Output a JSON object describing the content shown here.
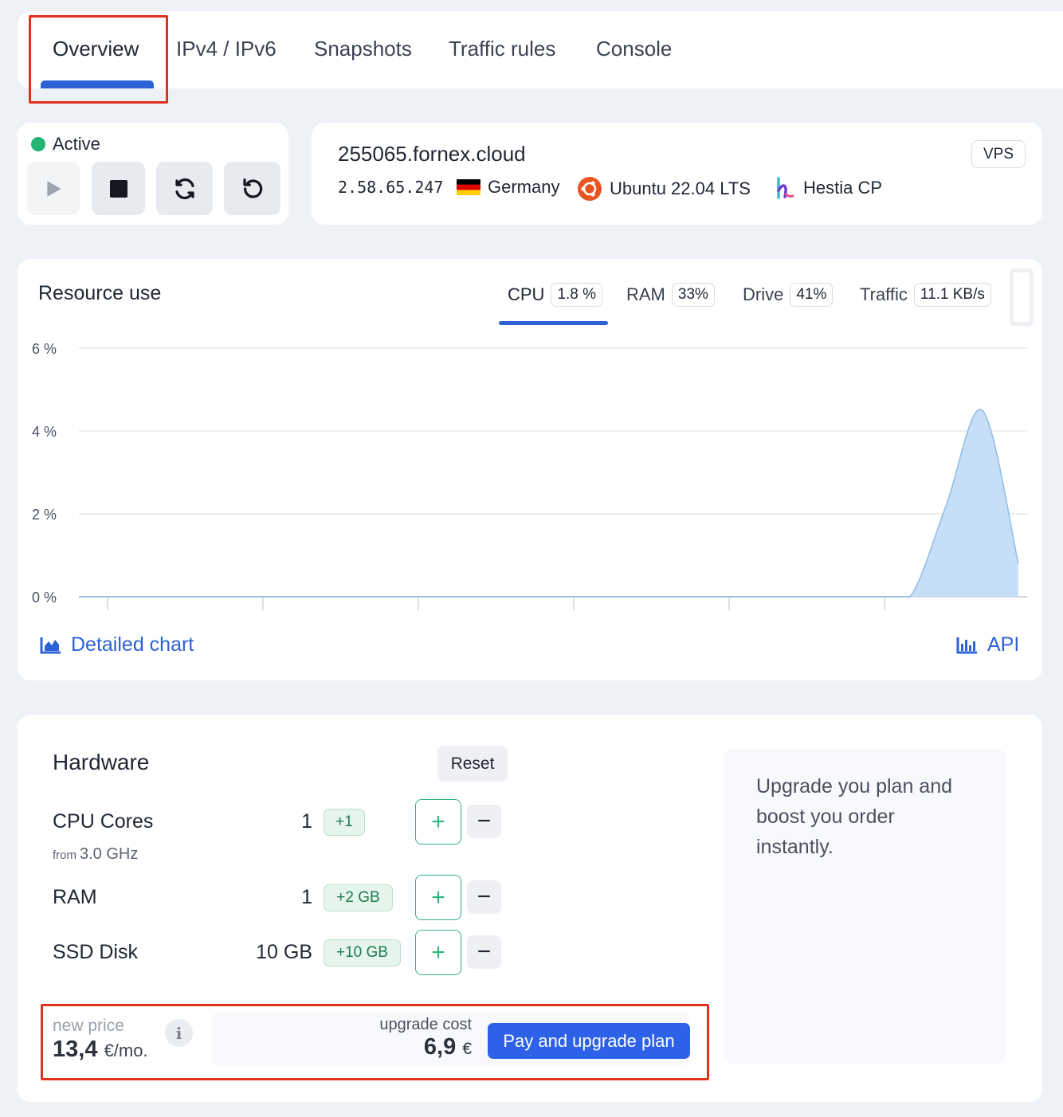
{
  "tabs": [
    "Overview",
    "IPv4 / IPv6",
    "Snapshots",
    "Traffic rules",
    "Console"
  ],
  "power": {
    "status": "Active",
    "status_color": "#22b573",
    "buttons": [
      {
        "name": "start",
        "icon": "play-icon",
        "disabled": true
      },
      {
        "name": "stop",
        "icon": "stop-icon"
      },
      {
        "name": "restart",
        "icon": "restart-icon"
      },
      {
        "name": "reinstall",
        "icon": "undo-icon"
      }
    ]
  },
  "server": {
    "hostname": "255065.fornex.cloud",
    "ip": "2.58.65.247",
    "country": "Germany",
    "country_icon": "germany-flag-icon",
    "os": "Ubuntu 22.04 LTS",
    "os_icon": "ubuntu-icon",
    "panel": "Hestia CP",
    "panel_icon": "hestia-icon",
    "type_badge": "VPS"
  },
  "resource": {
    "title": "Resource use",
    "tabs": [
      {
        "label": "CPU",
        "value": "1.8 %"
      },
      {
        "label": "RAM",
        "value": "33%"
      },
      {
        "label": "Drive",
        "value": "41%"
      },
      {
        "label": "Traffic",
        "value": "11.1 KB/s"
      }
    ],
    "active_tab": "CPU",
    "detailed_chart_label": "Detailed chart",
    "api_label": "API",
    "accent": "#2d62d6"
  },
  "chart_data": {
    "type": "area",
    "y_ticks": [
      "6 %",
      "4 %",
      "2 %",
      "0 %"
    ],
    "ylim": [
      0,
      6
    ],
    "x": [
      0,
      1,
      2,
      3,
      4,
      5,
      6,
      7,
      8,
      9,
      10,
      11,
      12,
      13,
      14,
      15,
      16,
      17,
      18,
      19,
      20,
      21,
      22,
      23,
      24,
      25,
      26
    ],
    "values": [
      0,
      0,
      0,
      0,
      0,
      0,
      0,
      0,
      0,
      0,
      0,
      0,
      0,
      0,
      0,
      0,
      0,
      0,
      0,
      0,
      0,
      0,
      0,
      0,
      2.2,
      4.5,
      0.8
    ],
    "fill": "#c7dff6",
    "stroke": "#8ebde8",
    "grid": true
  },
  "hardware": {
    "title": "Hardware",
    "reset_label": "Reset",
    "rows": [
      {
        "label": "CPU Cores",
        "value": "1",
        "delta": "+1",
        "sub_prefix": "from",
        "sub_value": "3.0 GHz"
      },
      {
        "label": "RAM",
        "value": "1",
        "delta": "+2 GB"
      },
      {
        "label": "SSD Disk",
        "value": "10 GB",
        "delta": "+10 GB"
      }
    ],
    "plus": "+",
    "minus": "−",
    "promo": "Upgrade you plan and boost you order instantly.",
    "new_price_label": "new price",
    "new_price_value": "13,4",
    "new_price_unit": "€/mo.",
    "upgrade_cost_label": "upgrade cost",
    "upgrade_cost_value": "6,9",
    "upgrade_cost_unit": "€",
    "pay_label": "Pay and upgrade plan"
  }
}
